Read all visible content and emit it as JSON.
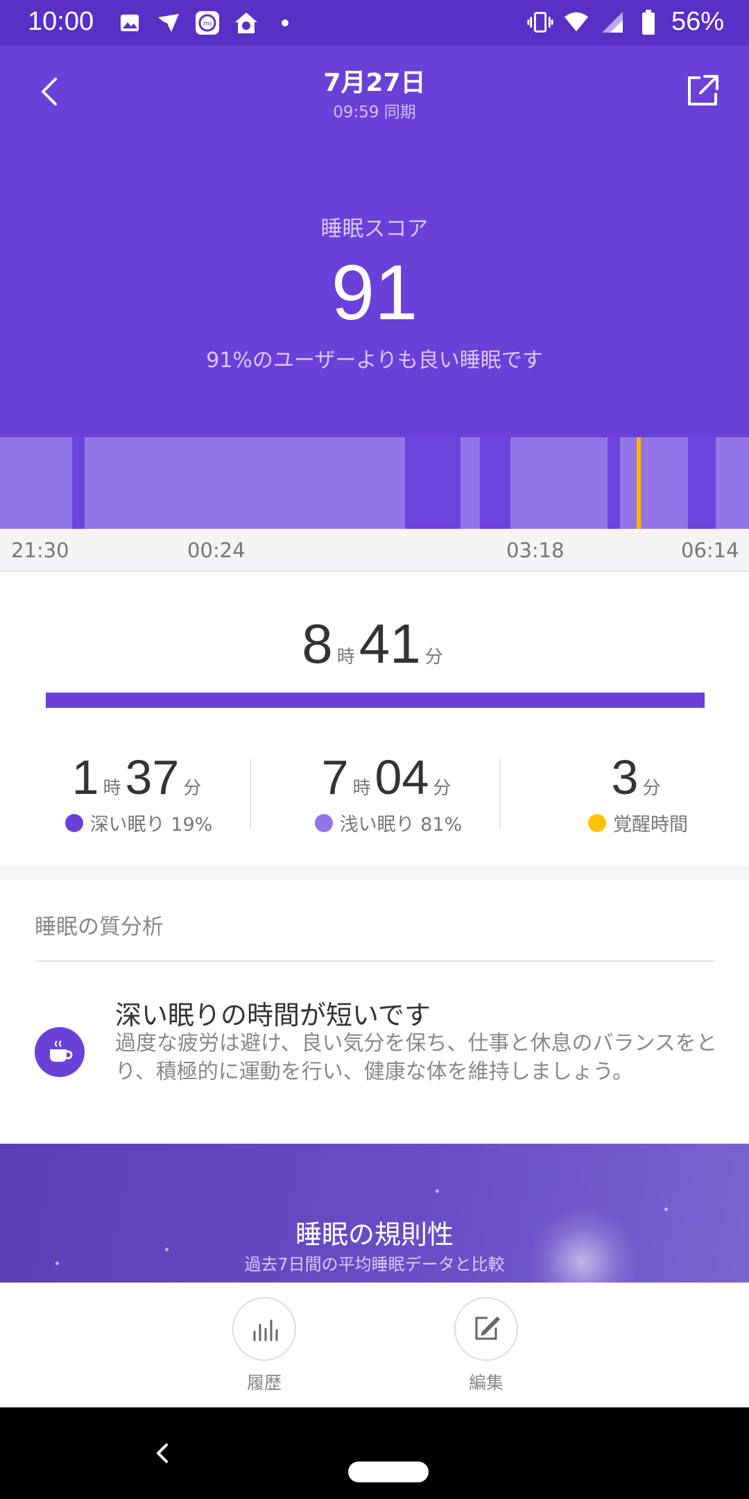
{
  "status_bar": {
    "time": "10:00",
    "battery": "56%",
    "icons": [
      "image-icon",
      "cast-icon",
      "mi-fit-icon",
      "home-icon",
      "dot-icon",
      "vibrate-icon",
      "wifi-icon",
      "signal-icon",
      "battery-icon"
    ]
  },
  "header": {
    "date": "7月27日",
    "sync": "09:59 同期",
    "score_label": "睡眠スコア",
    "score": "91",
    "score_desc": "91%のユーザーよりも良い睡眠です",
    "background_color": "#6b40d8"
  },
  "timeline": {
    "ticks": [
      "21:30",
      "00:24",
      "03:18",
      "06:14"
    ],
    "colors": {
      "light": "#9276e8",
      "deep": "#6d43dd",
      "awake": "#ffb300"
    }
  },
  "summary": {
    "total_hours": "8",
    "hours_unit": "時",
    "total_minutes": "41",
    "minutes_unit": "分",
    "stats": [
      {
        "hours": "1",
        "hours_unit": "時",
        "minutes": "37",
        "minutes_unit": "分",
        "label": "深い眠り 19%",
        "color": "#6b40d8"
      },
      {
        "hours": "7",
        "hours_unit": "時",
        "minutes": "04",
        "minutes_unit": "分",
        "label": "浅い眠り 81%",
        "color": "#9276e8"
      },
      {
        "minutes": "3",
        "minutes_unit": "分",
        "label": "覚醒時間",
        "color": "#ffc107"
      }
    ]
  },
  "analysis": {
    "title": "睡眠の質分析",
    "icon": "coffee-cup-icon",
    "advice_title": "深い眠りの時間が短いです",
    "advice_body": "過度な疲労は避け、良い気分を保ち、仕事と休息のバランスをとり、積極的に運動を行い、健康な体を維持しましょう。"
  },
  "regularity": {
    "title": "睡眠の規則性",
    "subtitle": "過去7日間の平均睡眠データと比較"
  },
  "actions": {
    "history_label": "履歴",
    "edit_label": "編集"
  }
}
